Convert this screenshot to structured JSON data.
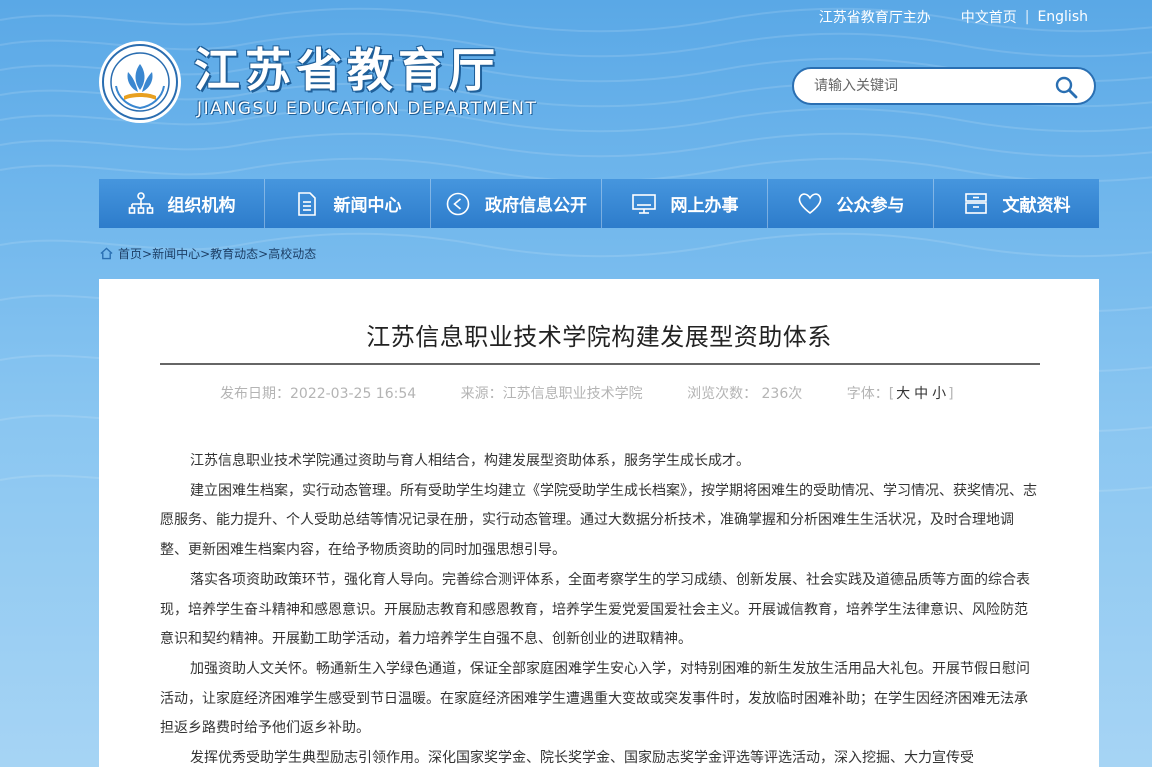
{
  "top_links": {
    "sponsor": "江苏省教育厅主办",
    "chinese_home": "中文首页",
    "separator": "|",
    "english": "English"
  },
  "logo": {
    "cn": "江苏省教育厅",
    "en": "JIANGSU EDUCATION DEPARTMENT"
  },
  "search": {
    "placeholder": "请输入关键词",
    "icon": "search-icon"
  },
  "nav": [
    {
      "label": "组织机构",
      "icon": "org-chart-icon"
    },
    {
      "label": "新闻中心",
      "icon": "document-icon"
    },
    {
      "label": "政府信息公开",
      "icon": "play-circle-icon"
    },
    {
      "label": "网上办事",
      "icon": "monitor-icon"
    },
    {
      "label": "公众参与",
      "icon": "heart-icon"
    },
    {
      "label": "文献资料",
      "icon": "archive-icon"
    }
  ],
  "breadcrumb": {
    "home": "首页",
    "sep": ">",
    "items": [
      "新闻中心",
      "教育动态",
      "高校动态"
    ]
  },
  "article": {
    "title": "江苏信息职业技术学院构建发展型资助体系",
    "publish_date": "发布日期：2022-03-25 16:54",
    "source": "来源：江苏信息职业技术学院",
    "views": "浏览次数： 236次",
    "font_label": "字体：",
    "font_open": "[",
    "font_large": "大",
    "font_medium": "中",
    "font_small": "小",
    "font_close": "]",
    "paragraphs": [
      "江苏信息职业技术学院通过资助与育人相结合，构建发展型资助体系，服务学生成长成才。",
      "建立困难生档案，实行动态管理。所有受助学生均建立《学院受助学生成长档案》，按学期将困难生的受助情况、学习情况、获奖情况、志愿服务、能力提升、个人受助总结等情况记录在册，实行动态管理。通过大数据分析技术，准确掌握和分析困难生生活状况，及时合理地调整、更新困难生档案内容，在给予物质资助的同时加强思想引导。",
      "落实各项资助政策环节，强化育人导向。完善综合测评体系，全面考察学生的学习成绩、创新发展、社会实践及道德品质等方面的综合表现，培养学生奋斗精神和感恩意识。开展励志教育和感恩教育，培养学生爱党爱国爱社会主义。开展诚信教育，培养学生法律意识、风险防范意识和契约精神。开展勤工助学活动，着力培养学生自强不息、创新创业的进取精神。",
      "加强资助人文关怀。畅通新生入学绿色通道，保证全部家庭困难学生安心入学，对特别困难的新生发放生活用品大礼包。开展节假日慰问活动，让家庭经济困难学生感受到节日温暖。在家庭经济困难学生遭遇重大变故或突发事件时，发放临时困难补助；在学生因经济困难无法承担返乡路费时给予他们返乡补助。",
      "发挥优秀受助学生典型励志引领作用。深化国家奖学金、院长奖学金、国家励志奖学金评选等评选活动，深入挖掘、大力宣传受"
    ]
  }
}
